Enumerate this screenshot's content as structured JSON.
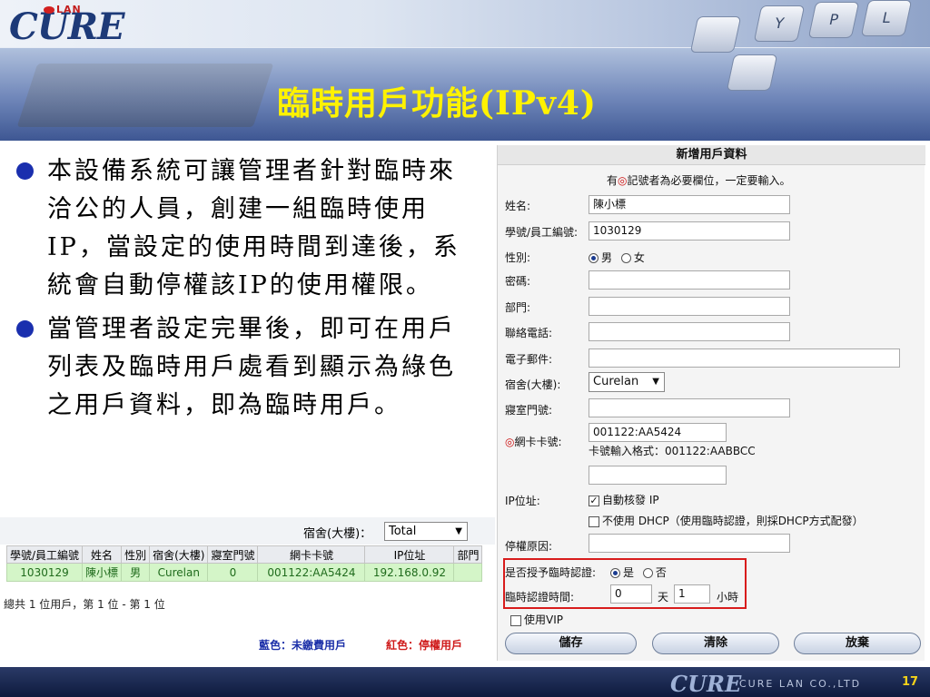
{
  "header": {
    "logo_main": "CURE",
    "logo_sub": "LAN",
    "title": "臨時用戶功能(IPv4)",
    "keys": [
      "Y",
      "P",
      "L"
    ]
  },
  "bullets": [
    "本設備系統可讓管理者針對臨時來洽公的人員，創建一組臨時使用IP，當設定的使用時間到達後，系統會自動停權該IP的使用權限。",
    "當管理者設定完畢後，即可在用戶列表及臨時用戶處看到顯示為綠色之用戶資料，即為臨時用戶。"
  ],
  "form": {
    "title": "新增用戶資料",
    "note_prefix": "有",
    "note_mark": "◎",
    "note_suffix": "記號者為必要欄位，一定要輸入。",
    "labels": {
      "name": "姓名:",
      "student_id": "學號/員工編號:",
      "gender": "性別:",
      "password": "密碼:",
      "department": "部門:",
      "phone": "聯絡電話:",
      "email": "電子郵件:",
      "dorm": "宿舍(大樓):",
      "room": "寢室門號:",
      "mac_mark": "◎",
      "mac": "網卡卡號:",
      "ip": "IP位址:",
      "suspend_reason": "停權原因:",
      "temp_auth": "是否授予臨時認證:",
      "temp_time": "臨時認證時間:"
    },
    "values": {
      "name": "陳小標",
      "student_id": "1030129",
      "gender_male": "男",
      "gender_female": "女",
      "password": "",
      "department": "",
      "phone": "",
      "email": "",
      "dorm": "Curelan",
      "room": "",
      "mac": "001122:AA5424",
      "mac_hint": "卡號輸入格式：001122:AABBCC",
      "mac_extra": "",
      "ip_auto": "自動核發 IP",
      "ip_no_dhcp": "不使用 DHCP（使用臨時認證，則採DHCP方式配發）",
      "suspend_reason": "",
      "auth_yes": "是",
      "auth_no": "否",
      "days": "0",
      "days_unit": "天",
      "hours": "1",
      "hours_unit": "小時",
      "use_vip": "使用VIP"
    },
    "state": {
      "gender": "male",
      "ip_auto_checked": true,
      "ip_no_dhcp_checked": false,
      "temp_auth": "yes",
      "use_vip_checked": false
    },
    "buttons": {
      "save": "儲存",
      "clear": "清除",
      "cancel": "放棄"
    }
  },
  "user_list": {
    "filter_label": "宿舍(大樓)：",
    "filter_value": "Total",
    "columns": [
      "學號/員工編號",
      "姓名",
      "性別",
      "宿舍(大樓)",
      "寢室門號",
      "網卡卡號",
      "IP位址",
      "部門"
    ],
    "rows": [
      [
        "1030129",
        "陳小標",
        "男",
        "Curelan",
        "0",
        "001122:AA5424",
        "192.168.0.92",
        ""
      ]
    ],
    "total": "總共 1 位用戶，第 1 位 - 第 1 位",
    "legend_blue": "藍色：未繳費用戶",
    "legend_red": "紅色：停權用戶"
  },
  "footer": {
    "logo": "CURE",
    "company": "CURE LAN CO.,LTD",
    "page": "17"
  }
}
